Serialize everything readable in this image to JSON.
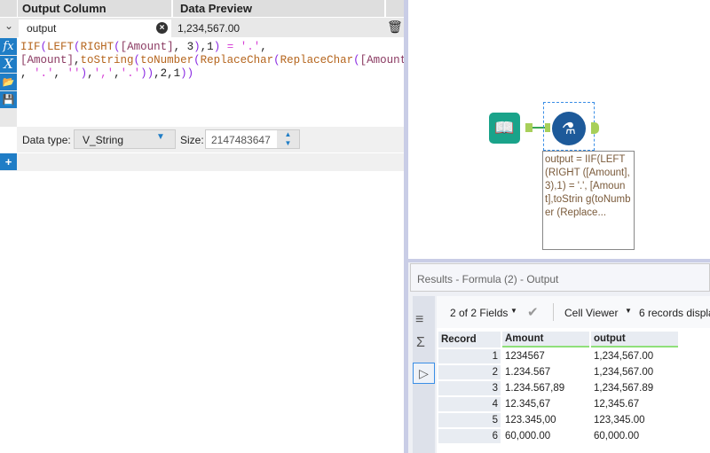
{
  "columns_header": {
    "output_column": "Output Column",
    "data_preview": "Data Preview"
  },
  "field": {
    "name": "output",
    "preview": "1,234,567.00"
  },
  "formula": {
    "lines": [
      [
        [
          "IIF",
          "fn"
        ],
        [
          "(",
          "br"
        ],
        [
          "LEFT",
          "fn"
        ],
        [
          "(",
          "br"
        ],
        [
          "RIGHT",
          "fn"
        ],
        [
          "(",
          "br"
        ],
        [
          "[Amount]",
          "fld"
        ],
        [
          ", ",
          "num"
        ],
        [
          "3",
          "num"
        ],
        [
          ")",
          "br"
        ],
        [
          ",",
          "num"
        ],
        [
          "1",
          "num"
        ],
        [
          ")",
          "br"
        ],
        [
          " = ",
          "str"
        ],
        [
          "'.'",
          "str"
        ],
        [
          ",",
          "num"
        ]
      ],
      [
        [
          "[Amount]",
          "fld"
        ],
        [
          ",",
          "num"
        ],
        [
          "toString",
          "fn"
        ],
        [
          "(",
          "br"
        ],
        [
          "toNumber",
          "fn"
        ],
        [
          "(",
          "br"
        ],
        [
          "ReplaceChar",
          "fn"
        ],
        [
          "(",
          "br"
        ],
        [
          "ReplaceChar",
          "fn"
        ],
        [
          "(",
          "br"
        ],
        [
          "[Amount]",
          "fld"
        ]
      ],
      [
        [
          ", ",
          "num"
        ],
        [
          "'.'",
          "str"
        ],
        [
          ", ",
          "num"
        ],
        [
          "''",
          "str"
        ],
        [
          ")",
          "br"
        ],
        [
          ",",
          "num"
        ],
        [
          "','",
          "str"
        ],
        [
          ",",
          "num"
        ],
        [
          "'.'",
          "str"
        ],
        [
          "))",
          "br"
        ],
        [
          ",2,1",
          "num"
        ],
        [
          "))",
          "br"
        ]
      ]
    ]
  },
  "datatype": {
    "label": "Data type:",
    "value": "V_String",
    "size_label": "Size:",
    "size_value": "2147483647"
  },
  "canvas": {
    "annotation": "output = IIF(LEFT (RIGHT ([Amount], 3),1) = '.', [Amount],toStrin g(toNumber (Replace..."
  },
  "results": {
    "title": "Results - Formula (2) - Output",
    "fields": "2 of 2 Fields",
    "viewer": "Cell Viewer",
    "records": "6 records displa",
    "headers": [
      "Record",
      "Amount",
      "output"
    ],
    "rows": [
      [
        "1",
        "1234567",
        "1,234,567.00"
      ],
      [
        "2",
        "1.234.567",
        "1,234,567.00"
      ],
      [
        "3",
        "1.234.567,89",
        "1,234,567.89"
      ],
      [
        "4",
        "12.345,67",
        "12,345.67"
      ],
      [
        "5",
        "123.345,00",
        "123,345.00"
      ],
      [
        "6",
        "60,000.00",
        "60,000.00"
      ]
    ]
  }
}
